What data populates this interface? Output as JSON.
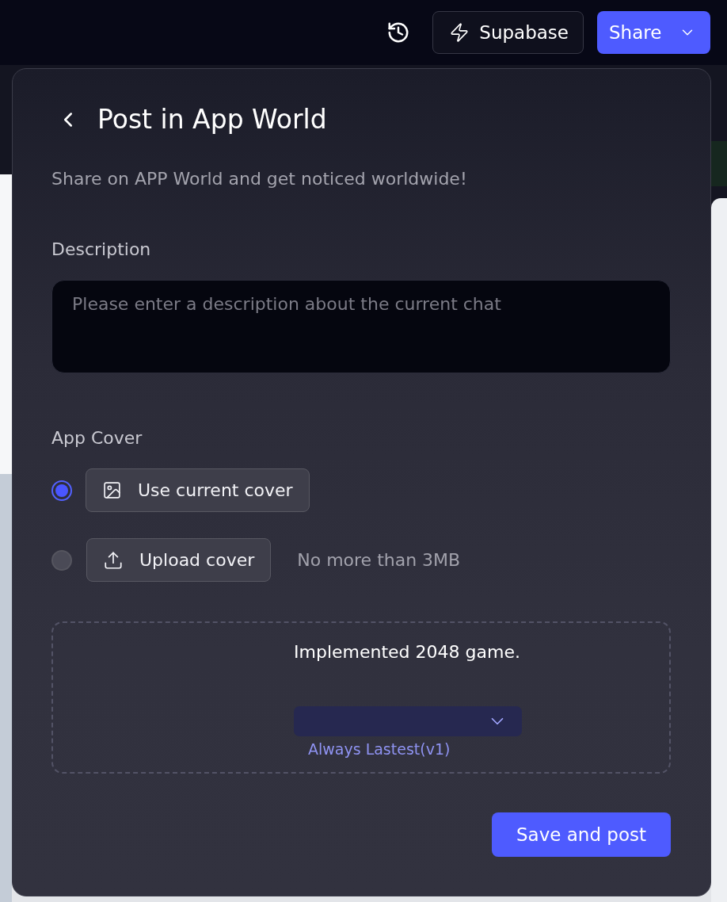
{
  "top_bar": {
    "supabase_button": {
      "label": "Supabase"
    },
    "share_button": {
      "label": "Share"
    }
  },
  "dialog": {
    "title": "Post in App World",
    "subtitle": "Share on APP World and get noticed worldwide!",
    "description": {
      "label": "Description",
      "placeholder": "Please enter a description about the current chat"
    },
    "app_cover": {
      "label": "App Cover",
      "options": [
        {
          "kind": "current",
          "label": "Use current cover",
          "selected": true
        },
        {
          "kind": "upload",
          "label": "Upload cover",
          "hint": "No more than 3MB",
          "selected": false
        }
      ],
      "preview": {
        "text": "Implemented 2048 game.",
        "version": "Always Lastest(v1)"
      }
    },
    "submit_button": {
      "label": "Save and post"
    }
  }
}
